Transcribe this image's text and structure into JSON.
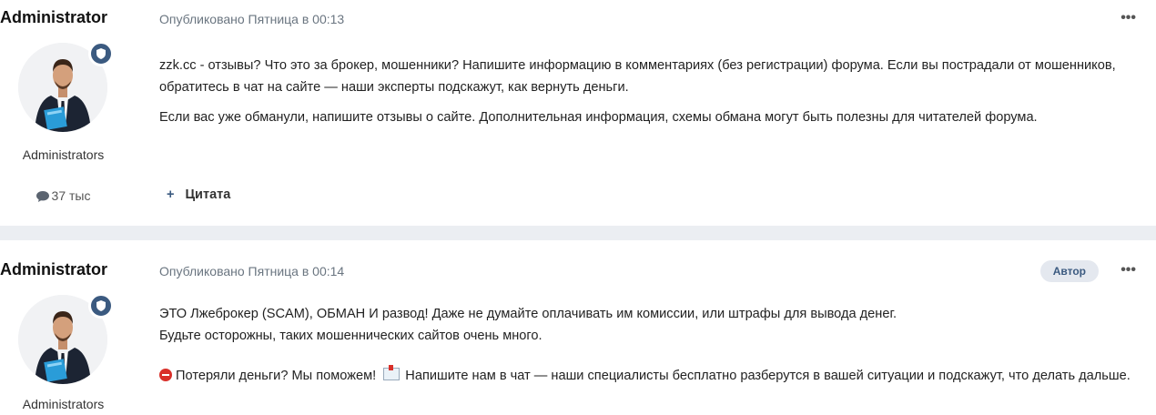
{
  "posts": [
    {
      "author_name": "Administrator",
      "group": "Administrators",
      "post_count": "37 тыс",
      "published": "Опубликовано Пятница в 00:13",
      "menu_icon": "ellipsis-icon",
      "menu_label": "•••",
      "paragraphs": [
        "zzk.cc - отзывы? Что это за брокер, мошенники? Напишите информацию в комментариях (без регистрации) форума. Если вы пострадали от мошенников, обратитесь в чат на сайте — наши эксперты подскажут, как вернуть деньги.",
        "Если вас уже обманули, напишите отзывы о сайте. Дополнительная информация, схемы обмана могут быть полезны для читателей форума."
      ],
      "quote_icon": "+",
      "quote_label": "Цитата"
    },
    {
      "author_name": "Administrator",
      "group": "Administrators",
      "published": "Опубликовано Пятница в 00:14",
      "author_badge": "Автор",
      "menu_label": "•••",
      "line1": "ЭТО Лжеброкер (SCAM), ОБМАН И развод! Даже не думайте оплачивать им комиссии, или штрафы для вывода денег.",
      "line2": "Будьте осторожны, таких мошеннических сайтов очень много.",
      "help_text_a": " Потеряли деньги? Мы поможем! ",
      "help_text_b": " Напишите нам в чат  — наши специалисты бесплатно разберутся в вашей ситуации и подскажут, что делать дальше."
    }
  ],
  "colors": {
    "accent": "#3b5a80",
    "meta_text": "#6a7580",
    "page_bg": "#ebeef2"
  }
}
